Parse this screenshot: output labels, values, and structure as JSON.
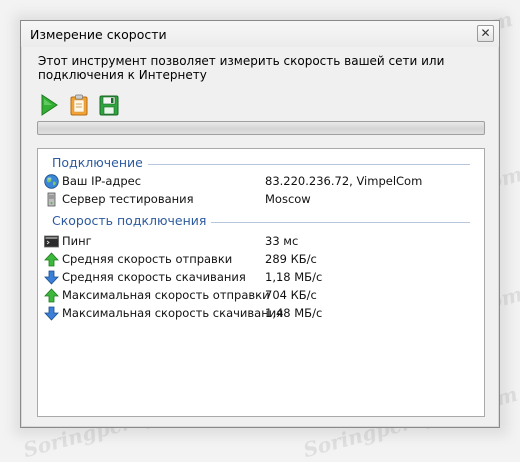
{
  "window": {
    "title": "Измерение скорости",
    "close_glyph": "✕"
  },
  "description": "Этот инструмент позволяет измерить скорость вашей сети или подключения к Интернету",
  "toolbar": {
    "buttons": [
      {
        "name": "play-icon",
        "color": "#2fa52f"
      },
      {
        "name": "clipboard-icon",
        "color": "#f0a030"
      },
      {
        "name": "save-disk-icon",
        "color": "#2a9a3a"
      }
    ]
  },
  "progress": {
    "value": 0
  },
  "connection": {
    "heading": "Подключение",
    "rows": [
      {
        "icon": "globe-icon",
        "label": "Ваш IP-адрес",
        "value": "83.220.236.72, VimpelCom"
      },
      {
        "icon": "server-icon",
        "label": "Сервер тестирования",
        "value": "Moscow"
      }
    ]
  },
  "speed": {
    "heading": "Скорость подключения",
    "rows": [
      {
        "icon": "terminal-icon",
        "label": "Пинг",
        "value": "33 мс"
      },
      {
        "icon": "arrow-up-icon",
        "label": "Средняя скорость отправки",
        "value": "289 КБ/с"
      },
      {
        "icon": "arrow-down-icon",
        "label": "Средняя скорость скачивания",
        "value": "1,18 МБ/с"
      },
      {
        "icon": "arrow-up-icon",
        "label": "Максимальная скорость отправки",
        "value": "704 КБ/с"
      },
      {
        "icon": "arrow-down-icon",
        "label": "Максимальная скорость скачивания",
        "value": "1,48 МБ/с"
      }
    ]
  },
  "watermark": "Soringpcrepair.com"
}
